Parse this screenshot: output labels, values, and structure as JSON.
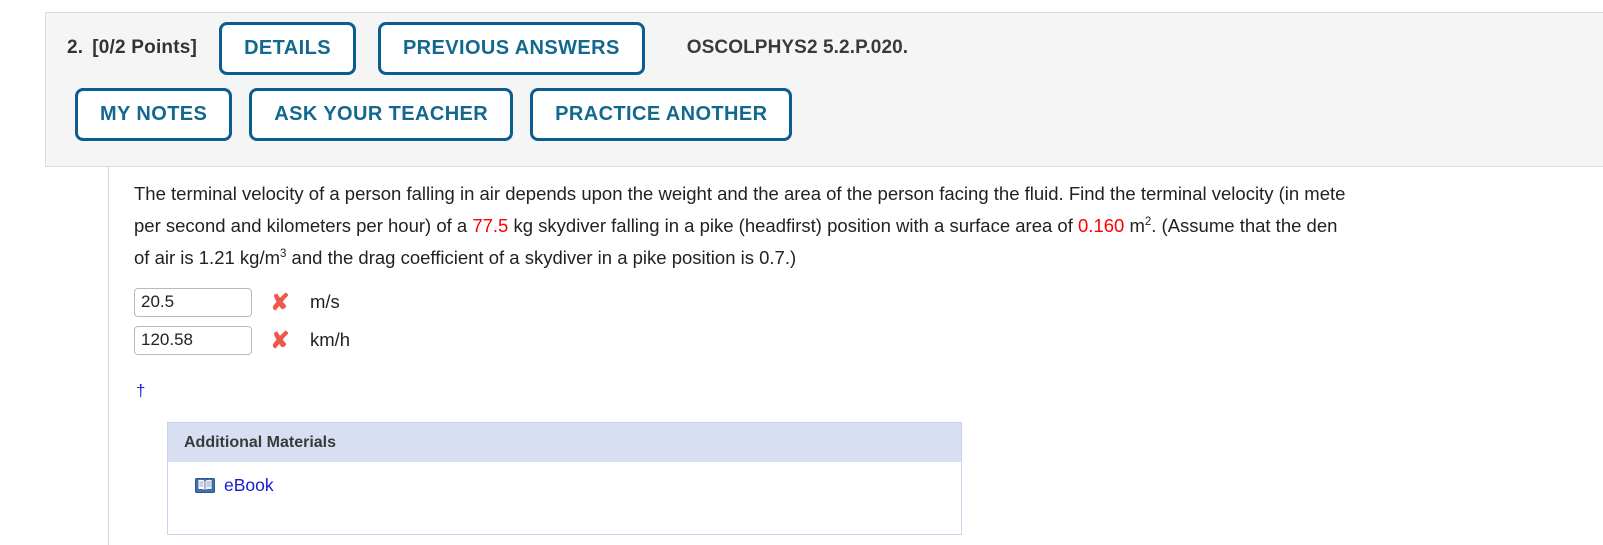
{
  "header": {
    "question_number": "2.",
    "points": "[0/2 Points]",
    "details_button": "DETAILS",
    "previous_answers_button": "PREVIOUS ANSWERS",
    "question_reference": "OSCOLPHYS2 5.2.P.020.",
    "my_notes_button": "MY NOTES",
    "ask_teacher_button": "ASK YOUR TEACHER",
    "practice_another_button": "PRACTICE ANOTHER"
  },
  "problem": {
    "line1_a": "The terminal velocity of a person falling in air depends upon the weight and the area of the person facing the fluid. Find the terminal velocity (in mete",
    "line2_a": "per second and kilometers per hour) of a ",
    "line2_value1": "77.5",
    "line2_b": " kg skydiver falling in a pike (headfirst) position with a surface area of ",
    "line2_value2": "0.160",
    "line2_c": " m",
    "line2_sup": "2",
    "line2_d": ". (Assume that the den",
    "line3_a": "of air is 1.21 kg/m",
    "line3_sup": "3",
    "line3_b": " and the drag coefficient of a skydiver in a pike position is 0.7.)",
    "footnote_symbol": "†"
  },
  "answers": [
    {
      "value": "20.5",
      "status": "✘",
      "unit": "m/s"
    },
    {
      "value": "120.58",
      "status": "✘",
      "unit": "km/h"
    }
  ],
  "materials": {
    "title": "Additional Materials",
    "ebook_label": "eBook",
    "ebook_icon": "book-icon"
  },
  "colors": {
    "button_border": "#0b5c8f",
    "button_text": "#12688f",
    "highlight_value": "#ff0000",
    "incorrect_mark": "#f0564a",
    "link": "#1818d6",
    "materials_header_bg": "#d8dff2",
    "panel_bg": "#f5f5f5"
  }
}
